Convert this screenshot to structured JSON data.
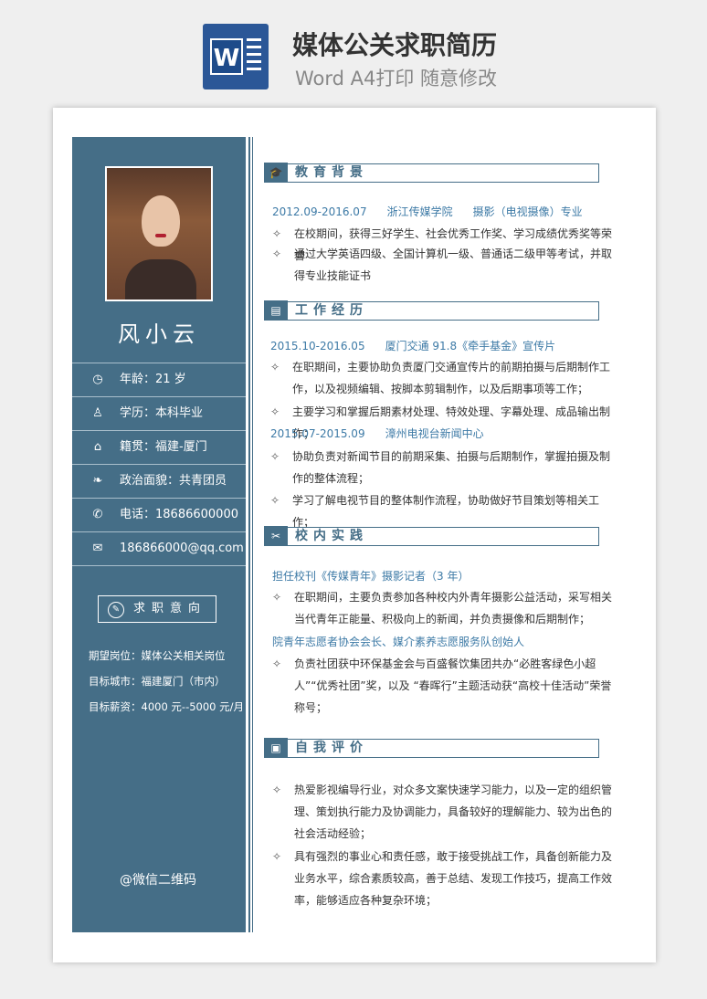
{
  "header": {
    "icon_letter": "W",
    "title": "媒体公关求职简历",
    "subtitle": "Word A4打印 随意修改"
  },
  "sidebar": {
    "name": "风小云",
    "info": [
      {
        "icon": "clock-icon",
        "glyph": "◷",
        "text": "年龄：21 岁"
      },
      {
        "icon": "graduate-icon",
        "glyph": "♙",
        "text": "学历：本科毕业"
      },
      {
        "icon": "home-icon",
        "glyph": "⌂",
        "text": "籍贯：福建-厦门"
      },
      {
        "icon": "leaf-icon",
        "glyph": "❧",
        "text": "政治面貌：共青团员"
      },
      {
        "icon": "phone-icon",
        "glyph": "✆",
        "text": "电话：18686600000"
      },
      {
        "icon": "mail-icon",
        "glyph": "✉",
        "text": "186866000@qq.com"
      }
    ],
    "intent_title": "求职意向",
    "intent_lines": [
      "期望岗位：媒体公关相关岗位",
      "目标城市：福建厦门（市内）",
      "目标薪资：4000 元--5000 元/月"
    ],
    "wechat": "@微信二维码"
  },
  "sections": {
    "education": {
      "title": "教育背景",
      "subhead": [
        "2012.09-2016.07",
        "浙江传媒学院",
        "摄影（电视摄像）专业"
      ],
      "bullets": [
        "在校期间，获得三好学生、社会优秀工作奖、学习成绩优秀奖等荣誉",
        "通过大学英语四级、全国计算机一级、普通话二级甲等考试，并取得专业技能证书"
      ]
    },
    "work": {
      "title": "工作经历",
      "job1_head": [
        "2015.10-2016.05",
        "厦门交通 91.8《牵手基金》宣传片"
      ],
      "job1_bullets": [
        "在职期间，主要协助负责厦门交通宣传片的前期拍摄与后期制作工作，以及视频编辑、按脚本剪辑制作，以及后期事项等工作；",
        "主要学习和掌握后期素材处理、特效处理、字幕处理、成品输出制作；"
      ],
      "job2_head": [
        "2015.07-2015.09",
        "漳州电视台新闻中心"
      ],
      "job2_bullets": [
        "协助负责对新闻节目的前期采集、拍摄与后期制作，掌握拍摄及制作的整体流程；",
        "学习了解电视节目的整体制作流程，协助做好节目策划等相关工作；"
      ]
    },
    "campus": {
      "title": "校内实践",
      "item1_head": "担任校刊《传媒青年》摄影记者（3 年）",
      "item1_bullets": [
        "在职期间，主要负责参加各种校内外青年摄影公益活动，采写相关当代青年正能量、积极向上的新闻，并负责摄像和后期制作；"
      ],
      "item2_head": "院青年志愿者协会会长、媒介素养志愿服务队创始人",
      "item2_bullets": [
        "负责社团获中环保基金会与百盛餐饮集团共办“必胜客绿色小超人”“优秀社团”奖，以及 “春晖行”主题活动获“高校十佳活动”荣誉称号；"
      ]
    },
    "self": {
      "title": "自我评价",
      "bullets": [
        "热爱影视编导行业，对众多文案快速学习能力，以及一定的组织管理、策划执行能力及协调能力，具备较好的理解能力、较为出色的社会活动经验；",
        "具有强烈的事业心和责任感，敢于接受挑战工作，具备创新能力及业务水平，综合素质较高，善于总结、发现工作技巧，提高工作效率，能够适应各种复杂环境；"
      ]
    }
  },
  "colors": {
    "accent": "#456e87",
    "subhead": "#3d7aa6"
  }
}
